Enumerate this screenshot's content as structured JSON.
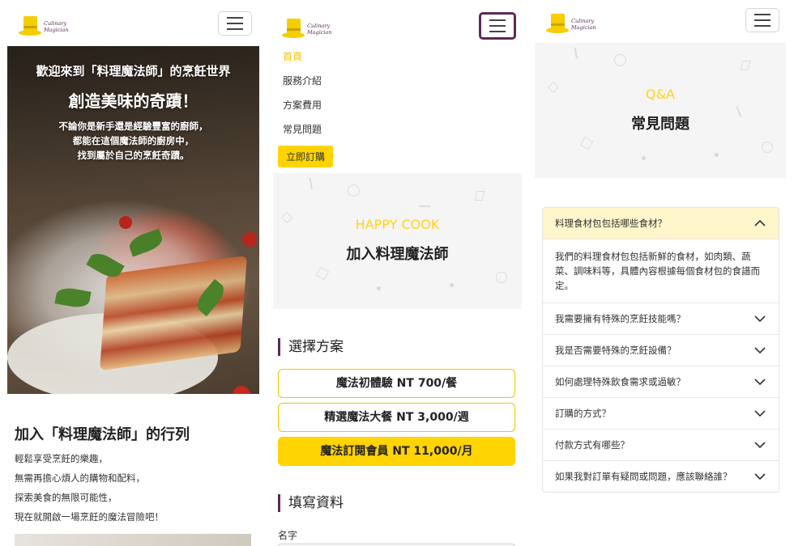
{
  "brand": {
    "logo_line1": "Culinary",
    "logo_line2": "Magician"
  },
  "home": {
    "hero_subtitle": "歡迎來到「料理魔法師」的烹飪世界",
    "hero_title": "創造美味的奇蹟！",
    "hero_desc_line1": "不論你是新手還是經驗豐富的廚師，",
    "hero_desc_line2": "都能在這個魔法師的廚房中，",
    "hero_desc_line3": "找到屬於自己的烹飪奇蹟。",
    "section_title": "加入「料理魔法師」的行列",
    "lines": [
      "輕鬆享受烹飪的樂趣，",
      "無需再擔心煩人的購物和配料，",
      "探索美食的無限可能性，",
      "現在就開啟一場烹飪的魔法冒險吧！"
    ]
  },
  "menu": {
    "items": [
      "首頁",
      "服務介紹",
      "方案費用",
      "常見問題"
    ],
    "order_button": "立即訂購"
  },
  "join": {
    "eyebrow": "HAPPY COOK",
    "title": "加入料理魔法師",
    "plans_heading": "選擇方案",
    "plans": [
      "魔法初體驗 NT 700/餐",
      "精選魔法大餐 NT 3,000/週",
      "魔法訂閱會員 NT 11,000/月"
    ],
    "selected_plan_index": 2,
    "form_heading": "填寫資料",
    "name_label": "名字"
  },
  "faq": {
    "eyebrow": "Q&A",
    "title": "常見問題",
    "open_question": "料理食材包包括哪些食材？",
    "open_answer": "我們的料理食材包包括新鮮的食材，如肉類、蔬菜、調味料等，具體內容根據每個食材包的食譜而定。",
    "questions": [
      "我需要擁有特殊的烹飪技能嗎？",
      "我是否需要特殊的烹飪設備？",
      "如何處理特殊飲食需求或過敏？",
      "訂購的方式？",
      "付款方式有哪些？",
      "如果我對訂單有疑問或問題，應該聯絡誰？"
    ]
  },
  "colors": {
    "accent_yellow": "#ffd400",
    "brand_purple": "#5b2a57",
    "eyebrow_yellow": "#ffd21e",
    "faq_open_bg": "#fff6cc"
  },
  "icons": {
    "menu": "hamburger-icon",
    "collapse": "chevron-up-icon",
    "expand": "chevron-down-icon",
    "logo": "top-hat-icon"
  }
}
